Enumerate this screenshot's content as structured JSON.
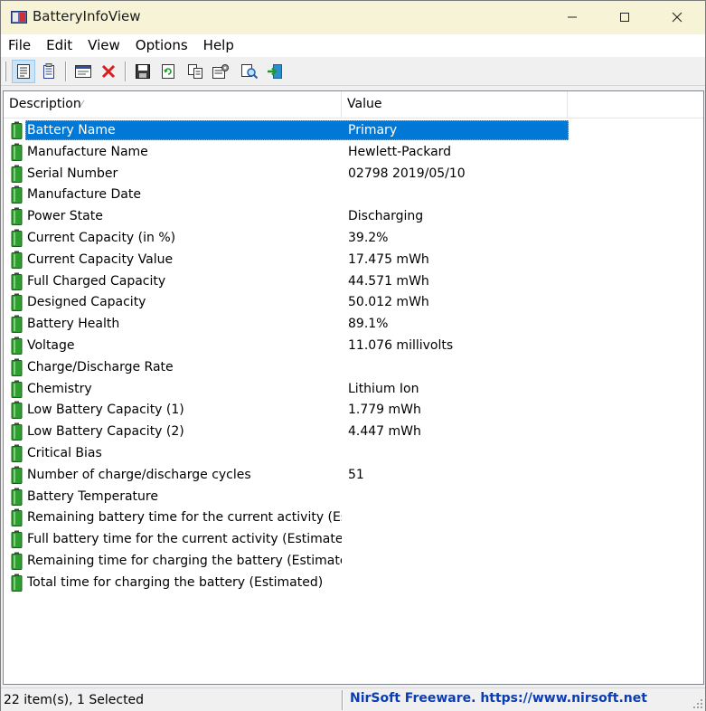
{
  "window": {
    "title": "BatteryInfoView"
  },
  "menu": [
    "File",
    "Edit",
    "View",
    "Options",
    "Help"
  ],
  "toolbar": {
    "buttons": [
      "properties-icon",
      "report-icon",
      "html-report-icon",
      "delete-icon",
      "save-icon",
      "refresh-icon",
      "copy-icon",
      "options-icon",
      "find-icon",
      "exit-icon"
    ]
  },
  "columns": {
    "description": "Description",
    "value": "Value"
  },
  "rows": [
    {
      "desc": "Battery Name",
      "val": "Primary"
    },
    {
      "desc": "Manufacture Name",
      "val": "Hewlett-Packard"
    },
    {
      "desc": "Serial Number",
      "val": "02798 2019/05/10"
    },
    {
      "desc": "Manufacture Date",
      "val": ""
    },
    {
      "desc": "Power State",
      "val": "Discharging"
    },
    {
      "desc": "Current Capacity (in %)",
      "val": "39.2%"
    },
    {
      "desc": "Current Capacity Value",
      "val": "17.475 mWh"
    },
    {
      "desc": "Full Charged Capacity",
      "val": "44.571 mWh"
    },
    {
      "desc": "Designed Capacity",
      "val": "50.012 mWh"
    },
    {
      "desc": "Battery Health",
      "val": "89.1%"
    },
    {
      "desc": "Voltage",
      "val": "11.076 millivolts"
    },
    {
      "desc": "Charge/Discharge Rate",
      "val": ""
    },
    {
      "desc": "Chemistry",
      "val": "Lithium Ion"
    },
    {
      "desc": "Low Battery Capacity (1)",
      "val": "1.779 mWh"
    },
    {
      "desc": "Low Battery Capacity (2)",
      "val": "4.447 mWh"
    },
    {
      "desc": "Critical Bias",
      "val": ""
    },
    {
      "desc": "Number of charge/discharge cycles",
      "val": "51"
    },
    {
      "desc": "Battery Temperature",
      "val": ""
    },
    {
      "desc": "Remaining battery time for the current activity (Est...",
      "val": ""
    },
    {
      "desc": "Full battery time for the current activity (Estimated)",
      "val": ""
    },
    {
      "desc": "Remaining time for charging the battery (Estimated)",
      "val": ""
    },
    {
      "desc": "Total  time for charging the battery (Estimated)",
      "val": ""
    }
  ],
  "selected_index": 0,
  "status": {
    "count": "22 item(s), 1 Selected",
    "brand": "NirSoft Freeware. https://www.nirsoft.net"
  },
  "colors": {
    "selection": "#0078d7",
    "title_bg": "#f6f3d6",
    "brand_link": "#0a3cb4",
    "battery_green": "#2e9e2e"
  }
}
